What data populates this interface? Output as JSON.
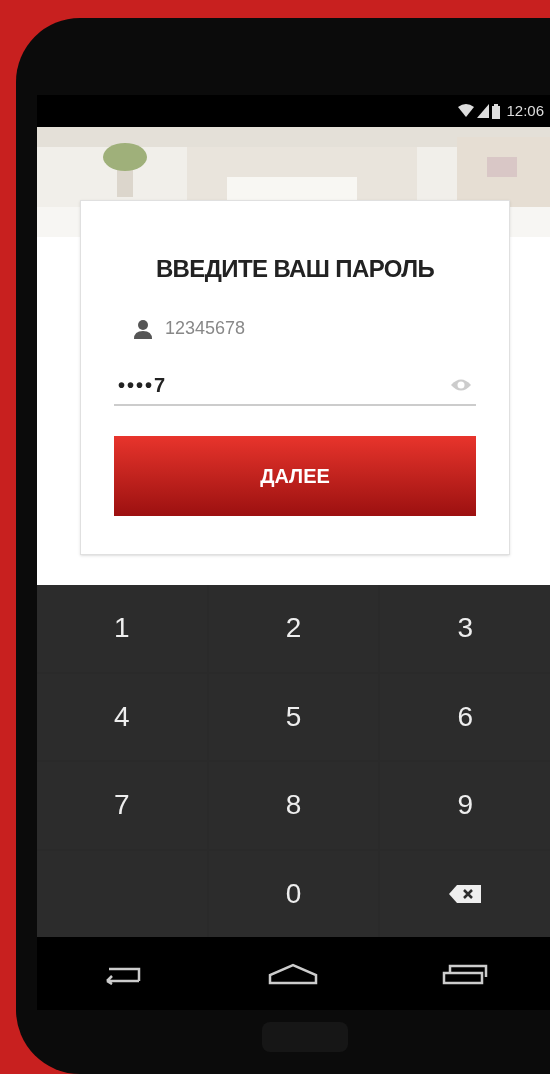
{
  "status_bar": {
    "time": "12:06"
  },
  "login_card": {
    "title": "ВВЕДИТЕ ВАШ ПАРОЛЬ",
    "account": "12345678",
    "password": "••••7",
    "button": "ДАЛЕЕ"
  },
  "keypad": [
    {
      "kind": "digit",
      "label": "1"
    },
    {
      "kind": "digit",
      "label": "2"
    },
    {
      "kind": "digit",
      "label": "3"
    },
    {
      "kind": "digit",
      "label": "4"
    },
    {
      "kind": "digit",
      "label": "5"
    },
    {
      "kind": "digit",
      "label": "6"
    },
    {
      "kind": "digit",
      "label": "7"
    },
    {
      "kind": "digit",
      "label": "8"
    },
    {
      "kind": "digit",
      "label": "9"
    },
    {
      "kind": "blank"
    },
    {
      "kind": "digit",
      "label": "0"
    },
    {
      "kind": "backspace"
    }
  ]
}
